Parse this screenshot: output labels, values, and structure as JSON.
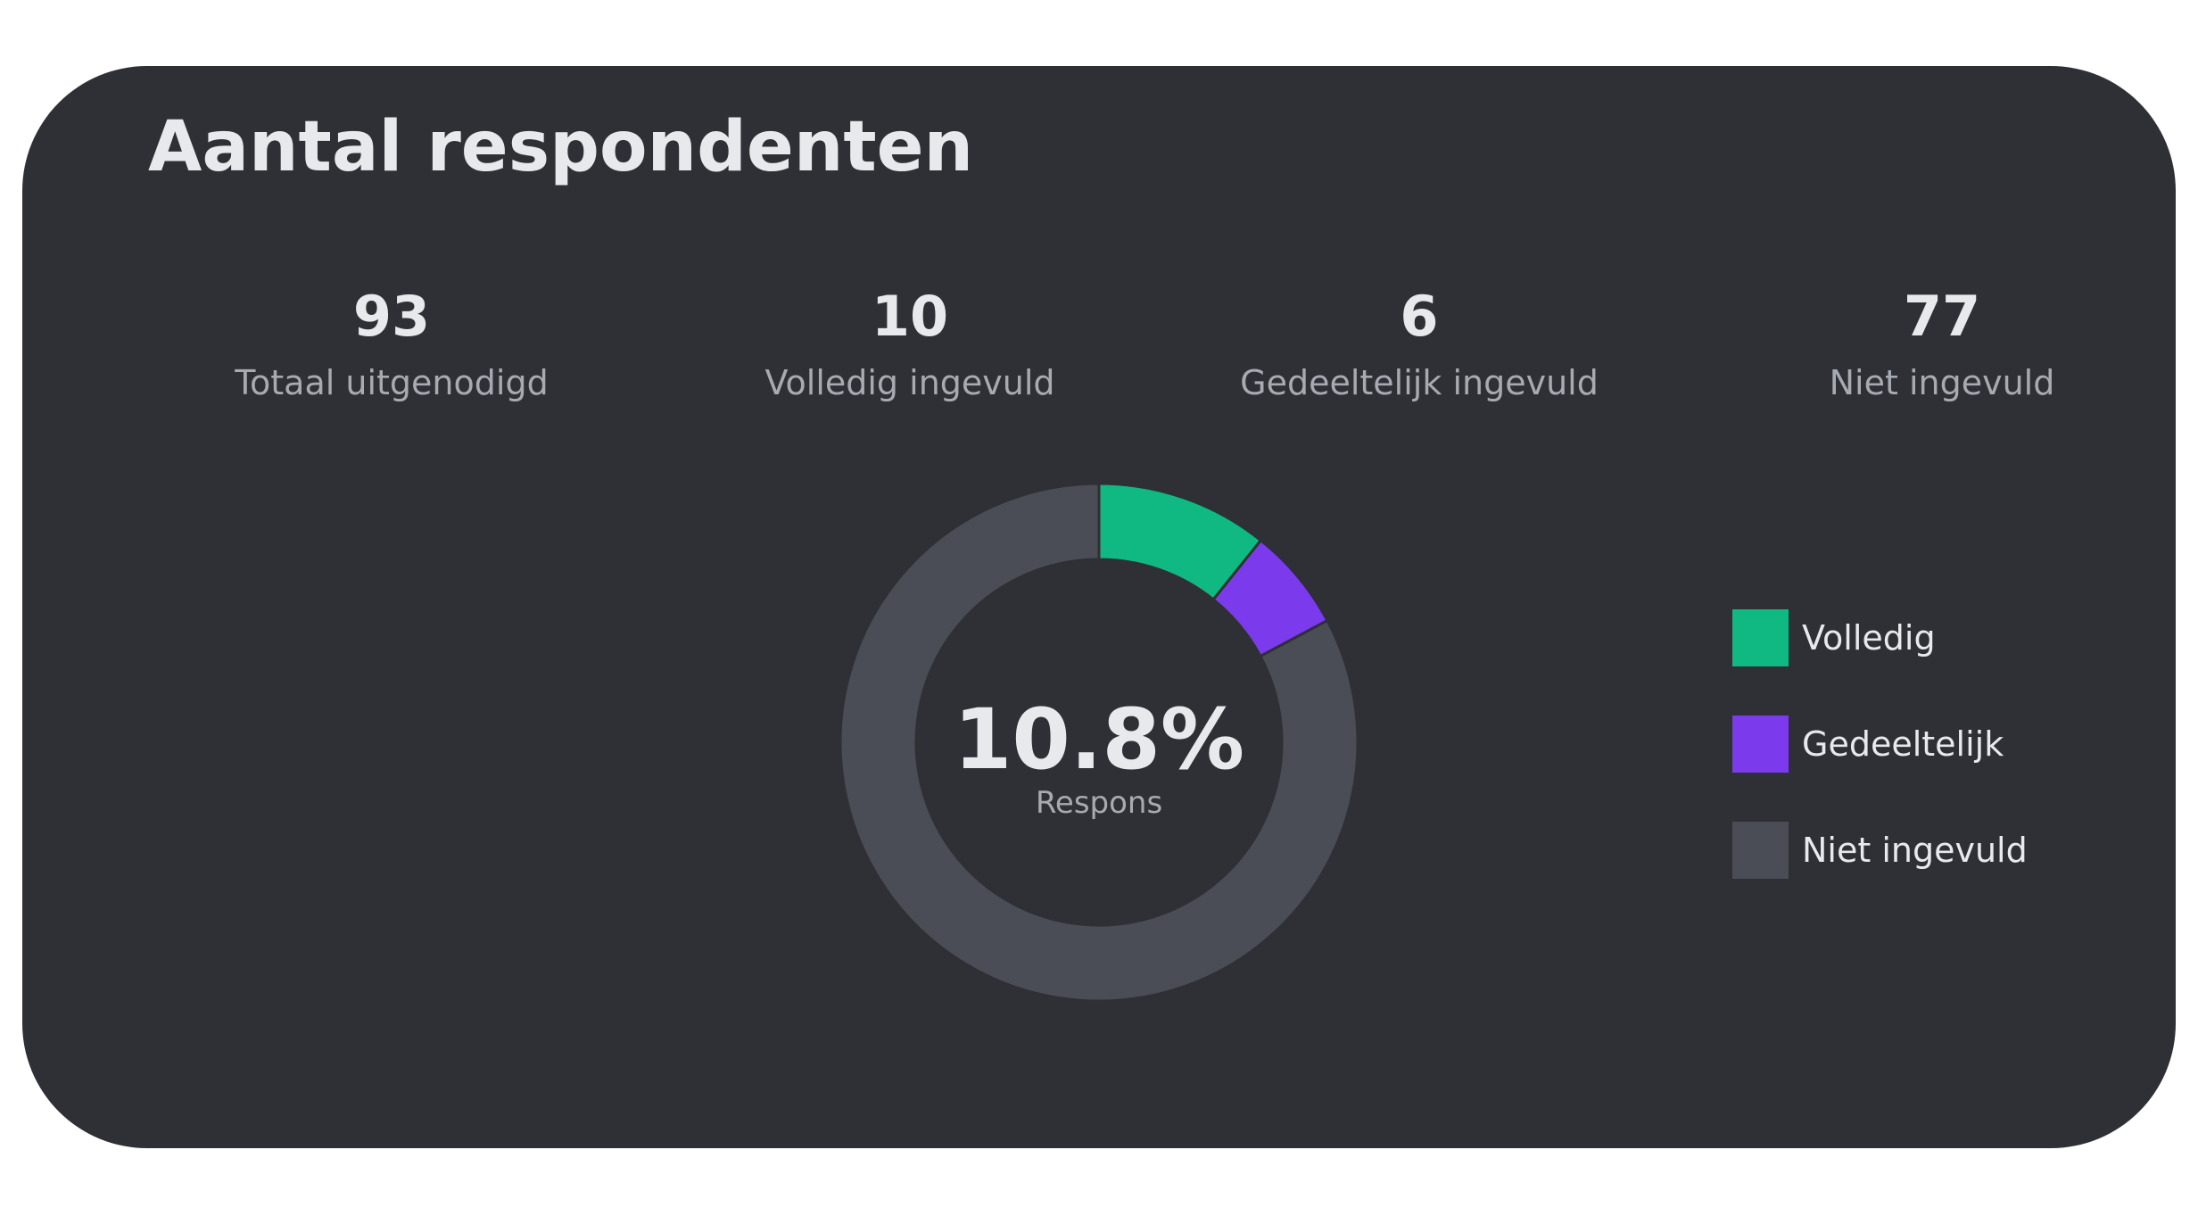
{
  "title": "Aantal respondenten",
  "stats": [
    {
      "value": "93",
      "label": "Totaal uitgenodigd"
    },
    {
      "value": "10",
      "label": "Volledig ingevuld"
    },
    {
      "value": "6",
      "label": "Gedeeltelijk ingevuld"
    },
    {
      "value": "77",
      "label": "Niet ingevuld"
    }
  ],
  "chart_data": {
    "type": "pie",
    "variant": "donut",
    "categories": [
      "Volledig",
      "Gedeeltelijk",
      "Niet ingevuld"
    ],
    "values": [
      10,
      6,
      77
    ],
    "colors": [
      "#10b981",
      "#7c3aed",
      "#4a4d55"
    ],
    "center_value": "10.8%",
    "center_label": "Respons",
    "legend_position": "right"
  },
  "colors": {
    "card_background": "#2e3035",
    "text_primary": "#e8e9ed",
    "text_secondary": "#a7aab1"
  }
}
